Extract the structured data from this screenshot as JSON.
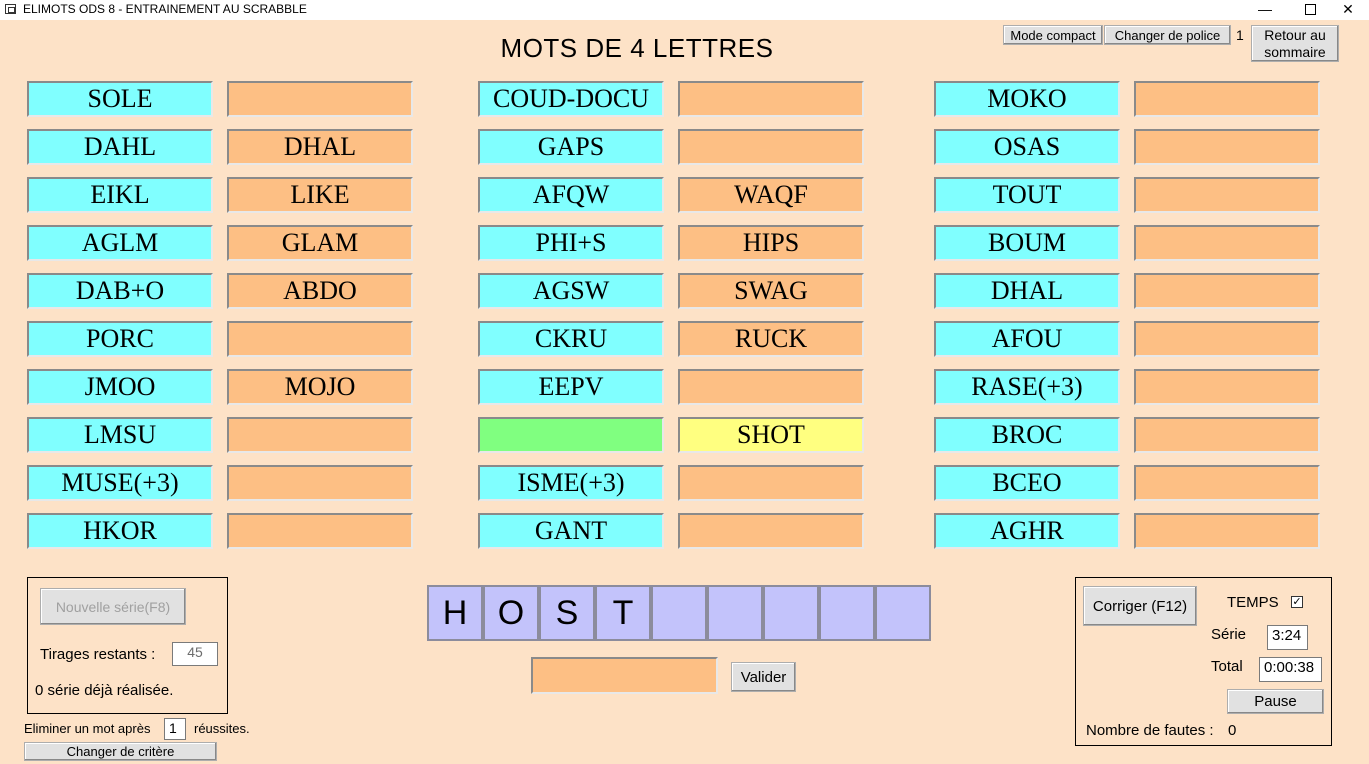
{
  "window": {
    "title": "ELIMOTS ODS 8 - ENTRAINEMENT AU SCRABBLE"
  },
  "page_title": "MOTS DE 4 LETTRES",
  "top_buttons": {
    "compact": "Mode compact",
    "font": "Changer de police",
    "font_number": "1",
    "back_line1": "Retour au",
    "back_line2": "sommaire"
  },
  "columns": [
    {
      "rows": [
        {
          "q": "SOLE",
          "a": "",
          "state": "normal"
        },
        {
          "q": "DAHL",
          "a": "DHAL",
          "state": "normal"
        },
        {
          "q": "EIKL",
          "a": "LIKE",
          "state": "normal"
        },
        {
          "q": "AGLM",
          "a": "GLAM",
          "state": "normal"
        },
        {
          "q": "DAB+O",
          "a": "ABDO",
          "state": "normal"
        },
        {
          "q": "PORC",
          "a": "",
          "state": "normal"
        },
        {
          "q": "JMOO",
          "a": "MOJO",
          "state": "normal"
        },
        {
          "q": "LMSU",
          "a": "",
          "state": "normal"
        },
        {
          "q": "MUSE(+3)",
          "a": "",
          "state": "normal"
        },
        {
          "q": "HKOR",
          "a": "",
          "state": "normal"
        }
      ]
    },
    {
      "rows": [
        {
          "q": "COUD-DOCU",
          "a": "",
          "state": "normal"
        },
        {
          "q": "GAPS",
          "a": "",
          "state": "normal"
        },
        {
          "q": "AFQW",
          "a": "WAQF",
          "state": "normal"
        },
        {
          "q": "PHI+S",
          "a": "HIPS",
          "state": "normal"
        },
        {
          "q": "AGSW",
          "a": "SWAG",
          "state": "normal"
        },
        {
          "q": "CKRU",
          "a": "RUCK",
          "state": "normal"
        },
        {
          "q": "EEPV",
          "a": "",
          "state": "normal"
        },
        {
          "q": "",
          "a": "SHOT",
          "state": "current"
        },
        {
          "q": "ISME(+3)",
          "a": "",
          "state": "normal"
        },
        {
          "q": "GANT",
          "a": "",
          "state": "normal"
        }
      ]
    },
    {
      "rows": [
        {
          "q": "MOKO",
          "a": "",
          "state": "normal"
        },
        {
          "q": "OSAS",
          "a": "",
          "state": "normal"
        },
        {
          "q": "TOUT",
          "a": "",
          "state": "normal"
        },
        {
          "q": "BOUM",
          "a": "",
          "state": "normal"
        },
        {
          "q": "DHAL",
          "a": "",
          "state": "normal"
        },
        {
          "q": "AFOU",
          "a": "",
          "state": "normal"
        },
        {
          "q": "RASE(+3)",
          "a": "",
          "state": "normal"
        },
        {
          "q": "BROC",
          "a": "",
          "state": "normal"
        },
        {
          "q": "BCEO",
          "a": "",
          "state": "normal"
        },
        {
          "q": "AGHR",
          "a": "",
          "state": "normal"
        }
      ]
    }
  ],
  "left_panel": {
    "new_series": "Nouvelle série(F8)",
    "remaining_label": "Tirages restants :",
    "remaining_value": "45",
    "series_done": "0 série déjà réalisée."
  },
  "eliminate": {
    "before": "Eliminer un mot après",
    "value": "1",
    "after": "réussites."
  },
  "change_criteria": "Changer de critère",
  "tiles": [
    "H",
    "O",
    "S",
    "T",
    "",
    "",
    "",
    "",
    ""
  ],
  "answer": {
    "value": "",
    "validate": "Valider"
  },
  "right_panel": {
    "correct": "Corriger (F12)",
    "time_label": "TEMPS",
    "time_checked": "✓",
    "serie_label": "Série",
    "serie_value": "3:24",
    "total_label": "Total",
    "total_value": "0:00:38",
    "pause": "Pause",
    "errors_label": "Nombre de fautes :",
    "errors_value": "0"
  },
  "colors": {
    "background": "#fde2c7",
    "question": "#80ffff",
    "answer": "#fdbf84",
    "current_question": "#80ff80",
    "current_answer": "#ffff80",
    "tile": "#c3c3fb"
  }
}
